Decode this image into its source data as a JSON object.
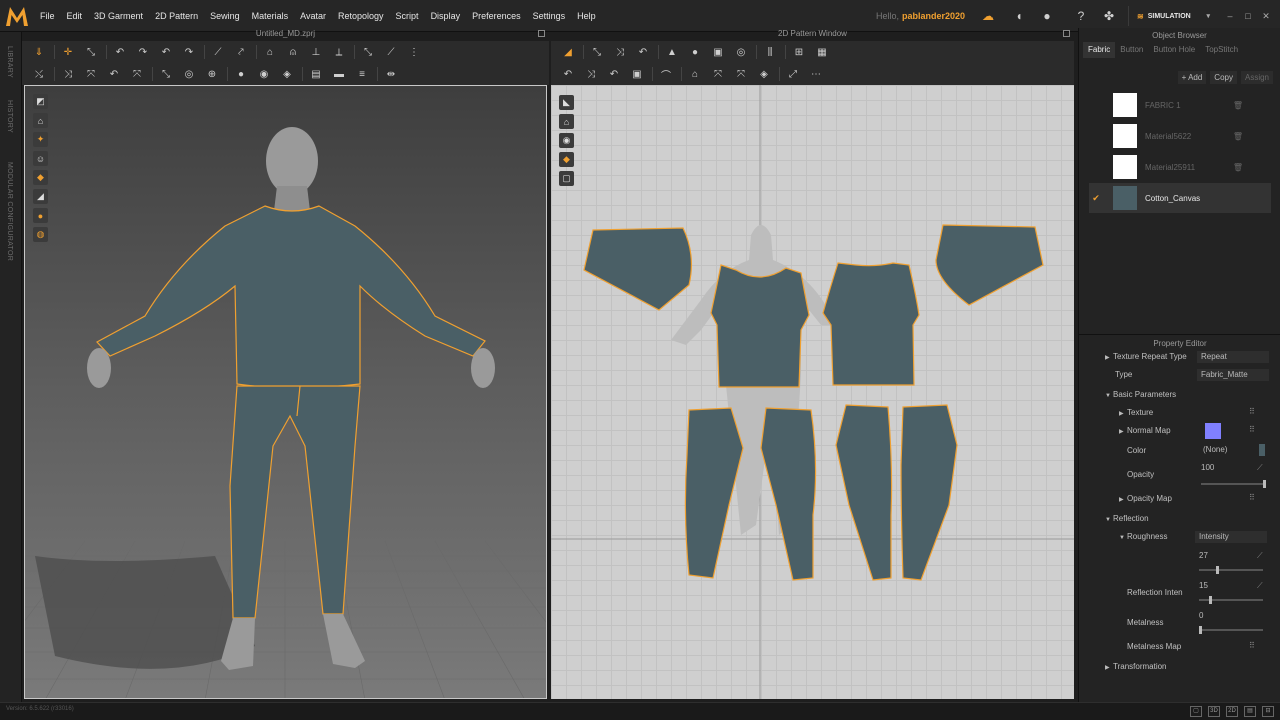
{
  "colors": {
    "accent": "#f0a030",
    "fabric": "#4a5f66",
    "fabric_dark": "#3e5259",
    "seam": "#f0a030",
    "bg_dark": "#1e1e1e",
    "panel": "#232323",
    "grid_bg": "#cfcfcf",
    "normal_map_swatch": "#8080ff",
    "white_swatch": "#ffffff"
  },
  "menu": [
    "File",
    "Edit",
    "3D Garment",
    "2D Pattern",
    "Sewing",
    "Materials",
    "Avatar",
    "Retopology",
    "Script",
    "Display",
    "Preferences",
    "Settings",
    "Help"
  ],
  "user": {
    "hello": "Hello,",
    "name": "pablander2020"
  },
  "mode": "SIMULATION",
  "left_tabs": [
    "LIBRARY",
    "HISTORY",
    "MODULAR CONFIGURATOR"
  ],
  "window3d": {
    "title": "Untitled_MD.zprj"
  },
  "window2d": {
    "title": "2D Pattern Window"
  },
  "object_browser": {
    "title": "Object Browser",
    "tabs": [
      "Fabric",
      "Button",
      "Button Hole",
      "TopStitch"
    ],
    "add_label": "+ Add",
    "copy_label": "Copy",
    "assign_label": "Assign",
    "fabrics": [
      {
        "name": "FABRIC 1",
        "color": "#ffffff",
        "selected": false
      },
      {
        "name": "Material5622",
        "color": "#ffffff",
        "selected": false
      },
      {
        "name": "Material25911",
        "color": "#ffffff",
        "selected": false
      },
      {
        "name": "Cotton_Canvas",
        "color": "#4a5f66",
        "selected": true
      }
    ]
  },
  "property_editor": {
    "title": "Property Editor",
    "texture_repeat_label": "Texture Repeat Type",
    "texture_repeat_value": "Repeat",
    "type_label": "Type",
    "type_value": "Fabric_Matte",
    "basic_params": "Basic Parameters",
    "texture": "Texture",
    "normal_map": "Normal Map",
    "color": "Color",
    "color_value": "(None)",
    "opacity": "Opacity",
    "opacity_value": "100",
    "opacity_map": "Opacity Map",
    "reflection": "Reflection",
    "roughness": "Roughness",
    "roughness_mode": "Intensity",
    "roughness_value": "27",
    "reflection_intensity": "Reflection Inten",
    "reflection_intensity_value": "15",
    "metalness": "Metalness",
    "metalness_value": "0",
    "metalness_map": "Metalness Map",
    "transformation": "Transformation"
  },
  "status": {
    "version": "Version: 6.5.622 (r33016)"
  }
}
